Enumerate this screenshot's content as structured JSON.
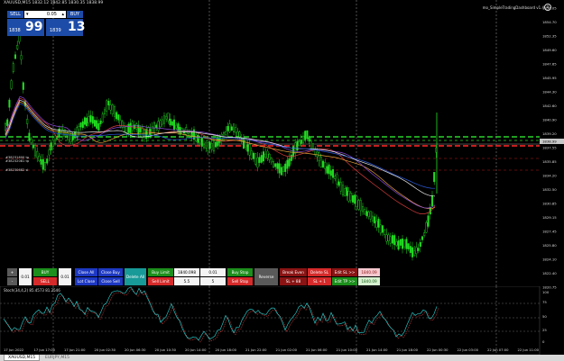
{
  "window": {
    "title": "XAUUSD,M15  1832.12 1842.85 1830.35 1838.99",
    "indicator_name": "mo_SimpleTradingDashboard v1.4",
    "settings_icon": "gear-icon"
  },
  "one_click": {
    "sell_label": "SELL",
    "buy_label": "BUY",
    "lot_value": "0.05",
    "lot_down": "▾",
    "lot_up": "▴",
    "sell_price_small": "1838",
    "sell_price_big": "99",
    "buy_price_small": "1839",
    "buy_price_big": "13"
  },
  "price_axis": {
    "labels": [
      "1856.05",
      "1854.70",
      "1852.35",
      "1849.60",
      "1847.65",
      "1845.95",
      "1844.30",
      "1842.60",
      "1840.90",
      "1839.20",
      "1837.55",
      "1835.85",
      "1834.20",
      "1832.50",
      "1830.85",
      "1829.15",
      "1827.45",
      "1825.80",
      "1824.10",
      "1822.40",
      "1820.75"
    ],
    "current_price": "1838.99",
    "current_price_color": "#c8c8c8"
  },
  "chart_annotations": {
    "line_label_1": "#38231600 tp",
    "line_label_2": "#38232081 tp",
    "line_label_3": "#38230682 sl"
  },
  "stochastic": {
    "title": "Stoch(34,4,2) 85.4573 81.2546",
    "levels": [
      "100",
      "75",
      "50",
      "25",
      "0"
    ]
  },
  "time_axis": {
    "labels": [
      "17 Jun 2022",
      "17 Jun 17:00",
      "17 Jun 21:00",
      "20 Jun 02:30",
      "20 Jun 06:30",
      "20 Jun 10:30",
      "20 Jun 14:00",
      "20 Jun 18:00",
      "21 Jun 22:00",
      "21 Jun 02:00",
      "21 Jun 06:00",
      "21 Jun 10:00",
      "21 Jun 14:00",
      "21 Jun 18:00",
      "22 Jun 00:30",
      "22 Jun 03:00",
      "22 Jun 07:00",
      "22 Jun 11:00"
    ]
  },
  "dashboard": {
    "plus": "+",
    "minus": "-",
    "lot_left": "0.01",
    "buy": "BUY",
    "sell": "SELL",
    "lot_right": "0.01",
    "close_all": "Close All",
    "close_buy": "Close Buy",
    "lot_close": "Lot Close",
    "close_sell": "Close Sell",
    "delete_all": "Delete All",
    "buy_limit": "Buy Limit",
    "buy_limit_price": "1840.098",
    "buy_limit_lot": "0.01",
    "buy_stop": "Buy Stop",
    "sell_limit": "Sell Limit",
    "sell_limit_price": "5.5",
    "sell_limit_lot": "5",
    "sell_stop": "Sell Stop",
    "reverse": "Reverse",
    "break_even": "Break Even",
    "delete_sl": "Delete SL",
    "edit_sl": "Edit SL >>",
    "edit_sl_value": "1840.09",
    "sl_minus": "SL + 88",
    "sl_plus": "SL + 1",
    "edit_tp": "Edit TP >>",
    "edit_tp_value": "1840.09"
  },
  "tabs": [
    {
      "label": "XAUUSD,M15",
      "active": true
    },
    {
      "label": "EURJPY,M15",
      "active": false
    }
  ]
}
